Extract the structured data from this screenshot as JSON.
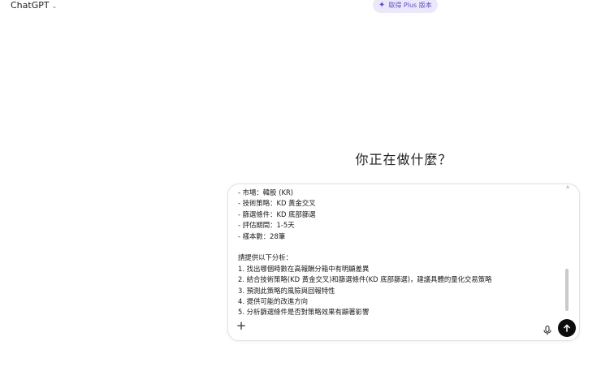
{
  "header": {
    "model_name": "ChatGPT",
    "upgrade_label": "取得 Plus 版本"
  },
  "main": {
    "headline": "你正在做什麼？"
  },
  "composer": {
    "prompt_lines": [
      "- 市場：韓股 (KR)",
      "- 技術策略：KD 黃金交叉",
      "- 篩選條件：KD 底部篩選",
      "- 評估期間：1-5天",
      "- 樣本數：28筆",
      "",
      "請提供以下分析：",
      "1. 找出哪個時數在高報酬分箱中有明顯差異",
      "2. 結合技術策略(KD 黃金交叉)和篩選條件(KD 底部篩選)，建議具體的量化交易策略",
      "3. 預測此策略的風險與回報特性",
      "4. 提供可能的改進方向",
      "5. 分析篩選條件是否對策略效果有顯著影響"
    ],
    "icons": {
      "add": "plus-icon",
      "mic": "microphone-icon",
      "send": "arrow-up-icon",
      "model_switch": "chevron-down-icon",
      "upgrade": "sparkle-icon"
    },
    "accent_color": "#0d0d0d",
    "pill_color": "#ece8fb"
  }
}
